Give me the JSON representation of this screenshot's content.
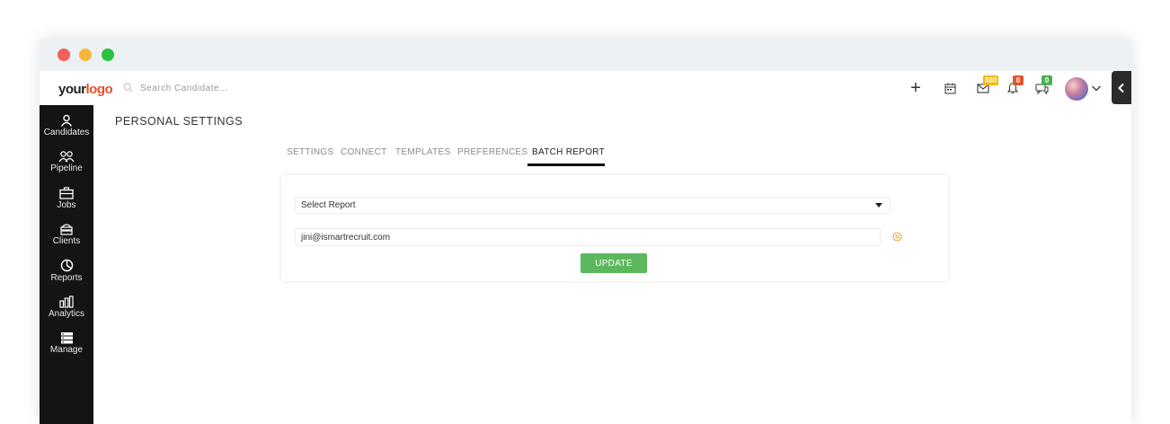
{
  "logo": {
    "part1": "your",
    "part2": "logo"
  },
  "search": {
    "placeholder": "Search Candidate..."
  },
  "header": {
    "mail_badge": "880",
    "notification_badge": "0",
    "chat_badge": "0",
    "colors": {
      "mail": "#f5b800",
      "notification": "#e2532d",
      "chat": "#4caf50"
    }
  },
  "sidebar": {
    "items": [
      {
        "label": "Candidates",
        "icon": "person-icon"
      },
      {
        "label": "Pipeline",
        "icon": "people-icon"
      },
      {
        "label": "Jobs",
        "icon": "briefcase-icon"
      },
      {
        "label": "Clients",
        "icon": "clients-icon"
      },
      {
        "label": "Reports",
        "icon": "pie-chart-icon"
      },
      {
        "label": "Analytics",
        "icon": "bar-chart-icon"
      },
      {
        "label": "Manage",
        "icon": "server-icon"
      }
    ]
  },
  "page": {
    "title": "PERSONAL SETTINGS"
  },
  "tabs": [
    {
      "label": "SETTINGS"
    },
    {
      "label": "CONNECT"
    },
    {
      "label": "TEMPLATES"
    },
    {
      "label": "PREFERENCES"
    },
    {
      "label": "BATCH REPORT",
      "active": true
    }
  ],
  "form": {
    "select_value": "Select Report",
    "email_value": "jini@ismartrecruit.com",
    "update_label": "UPDATE",
    "update_color": "#5cb85c"
  }
}
